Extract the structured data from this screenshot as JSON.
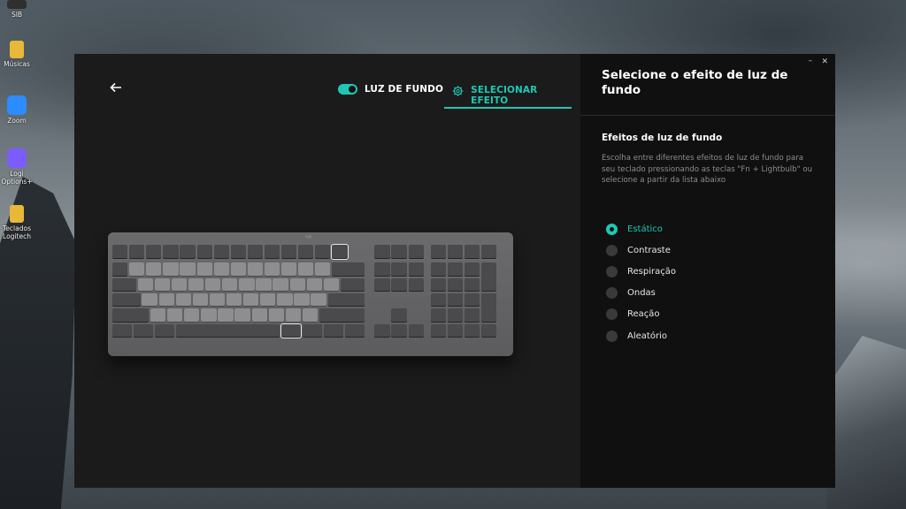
{
  "desktop": {
    "icons": [
      {
        "label": "SIB",
        "color": "#2f2f2f"
      },
      {
        "label": "Músicas",
        "color": "#f0c040"
      },
      {
        "label": "Zoom",
        "color": "#2d8cff"
      },
      {
        "label": "Logi Options+",
        "color": "#7b5cff"
      },
      {
        "label": "Teclados Logitech",
        "color": "#f0c040"
      }
    ]
  },
  "app": {
    "back_icon": "arrow-left-icon",
    "tabs": {
      "backlight_label": "LUZ DE FUNDO",
      "backlight_enabled": true,
      "effect_label": "SELECIONAR EFEITO",
      "effect_icon": "gear-icon"
    },
    "accent_color": "#1ec8b4"
  },
  "panel": {
    "title": "Selecione o efeito de luz de fundo",
    "minimize_glyph": "–",
    "close_glyph": "✕",
    "subtitle": "Efeitos de luz de fundo",
    "description": "Escolha entre diferentes efeitos de luz de fundo para seu teclado pressionando as teclas \"Fn + Lightbulb\" ou selecione a partir da lista abaixo",
    "options": [
      {
        "label": "Estático",
        "selected": true
      },
      {
        "label": "Contraste",
        "selected": false
      },
      {
        "label": "Respiração",
        "selected": false
      },
      {
        "label": "Ondas",
        "selected": false
      },
      {
        "label": "Reação",
        "selected": false
      },
      {
        "label": "Aleatório",
        "selected": false
      }
    ]
  },
  "keyboard": {
    "brand": "logi",
    "highlighted_keys": [
      "backlight-key",
      "fn-key"
    ]
  }
}
